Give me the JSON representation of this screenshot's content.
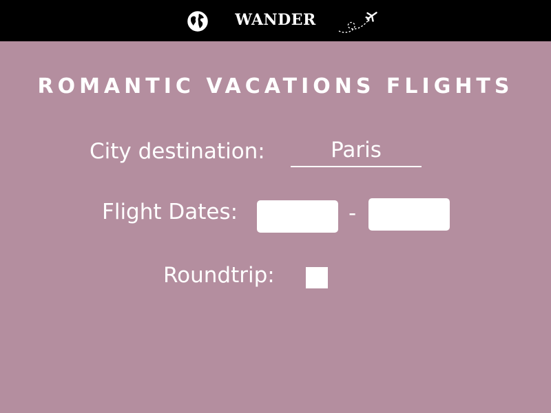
{
  "header": {
    "brand": "WANDER",
    "left_icon": "globe-icon",
    "right_icon": "airplane-trail-icon"
  },
  "title": "ROMANTIC VACATIONS FLIGHTS",
  "form": {
    "city_label": "City destination:",
    "city_value": "Paris",
    "dates_label": "Flight Dates:",
    "dates_separator": "-",
    "start_date_value": "",
    "end_date_value": "",
    "roundtrip_label": "Roundtrip:",
    "roundtrip_checked": false
  },
  "colors": {
    "background": "#b48e9f",
    "header": "#000000",
    "text": "#ffffff"
  }
}
